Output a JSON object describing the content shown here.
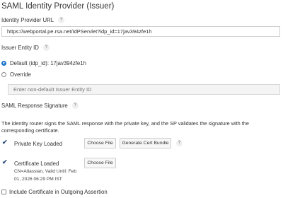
{
  "header": {
    "title": "SAML Identity Provider (Issuer)"
  },
  "idp_url": {
    "label": "Identity Provider URL",
    "value": "https://webportal.pe.rsa.net/IdPServlet?idp_id=17jav394zfe1h"
  },
  "issuer_entity": {
    "label": "Issuer Entity ID",
    "default_option": "Default (idp_id): 17jav394zfe1h",
    "override_option": "Override",
    "override_placeholder": "Enter non-default Issuer Entity ID",
    "selected": "default"
  },
  "saml_signature": {
    "label": "SAML Response Signature",
    "description": "The identity router signs the SAML response with the private key, and the SP validates the signature with the corresponding certificate.",
    "private_key": {
      "status": "Private Key Loaded",
      "choose_file": "Choose File",
      "generate": "Generate Cert Bundle"
    },
    "certificate": {
      "status": "Certificate Loaded",
      "details_line1": "CN=Atlassian, Valid Until: Feb",
      "details_line2": "01, 2026 06:29 PM IST",
      "choose_file": "Choose File"
    },
    "include_cert": {
      "label": "Include Certificate in Outgoing Assertion",
      "checked": false
    }
  },
  "icons": {
    "help": "?",
    "check": "✔"
  },
  "colors": {
    "accent": "#1a73c9",
    "check": "#2a4d7a"
  }
}
